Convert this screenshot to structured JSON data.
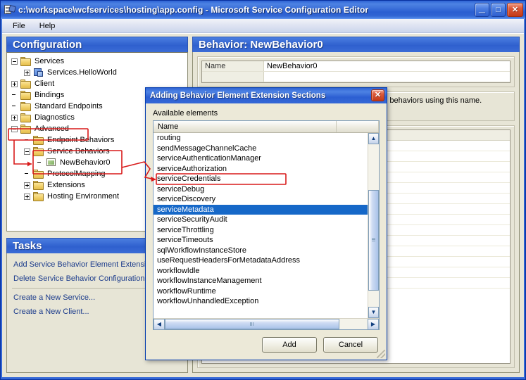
{
  "window": {
    "title": "c:\\workspace\\wcfservices\\hosting\\app.config - Microsoft Service Configuration Editor",
    "icon": "app-config-icon",
    "controls": {
      "minimize": "_",
      "maximize": "□",
      "close": "✕"
    }
  },
  "menu": {
    "items": [
      {
        "label": "File"
      },
      {
        "label": "Help"
      }
    ]
  },
  "configuration_panel": {
    "title": "Configuration",
    "tree": [
      {
        "label": "Services",
        "depth": 0,
        "expander": "minus",
        "icon": "folder-icon"
      },
      {
        "label": "Services.HelloWorld",
        "depth": 1,
        "expander": "plus",
        "icon": "service-icon"
      },
      {
        "label": "Client",
        "depth": 0,
        "expander": "plus",
        "icon": "folder-icon"
      },
      {
        "label": "Bindings",
        "depth": 0,
        "expander": "none",
        "icon": "folder-icon"
      },
      {
        "label": "Standard Endpoints",
        "depth": 0,
        "expander": "none",
        "icon": "folder-icon"
      },
      {
        "label": "Diagnostics",
        "depth": 0,
        "expander": "plus",
        "icon": "folder-icon"
      },
      {
        "label": "Advanced",
        "depth": 0,
        "expander": "minus",
        "icon": "folder-icon"
      },
      {
        "label": "Endpoint Behaviors",
        "depth": 1,
        "expander": "none",
        "icon": "folder-icon"
      },
      {
        "label": "Service Behaviors",
        "depth": 1,
        "expander": "minus",
        "icon": "folder-icon"
      },
      {
        "label": "NewBehavior0",
        "depth": 2,
        "expander": "none",
        "icon": "behavior-icon"
      },
      {
        "label": "ProtocolMapping",
        "depth": 1,
        "expander": "none",
        "icon": "folder-icon"
      },
      {
        "label": "Extensions",
        "depth": 1,
        "expander": "plus",
        "icon": "folder-icon"
      },
      {
        "label": "Hosting Environment",
        "depth": 1,
        "expander": "plus",
        "icon": "folder-icon"
      }
    ]
  },
  "tasks_panel": {
    "title": "Tasks",
    "items": [
      {
        "label": "Add Service Behavior Element Extension"
      },
      {
        "label": "Delete Service Behavior Configuration"
      },
      {
        "label": "Create a New Service..."
      },
      {
        "label": "Create a New Client..."
      }
    ]
  },
  "behavior_panel": {
    "title": "Behavior: NewBehavior0",
    "properties": [
      {
        "key": "Name",
        "value": "NewBehavior0"
      }
    ],
    "description": "Each behavior is indexed by its name. Services link to behaviors using this name. Behaviors are define..."
  },
  "dialog": {
    "title": "Adding Behavior Element Extension Sections",
    "close_label": "✕",
    "available_label": "Available elements",
    "column_header": "Name",
    "items": [
      "routing",
      "sendMessageChannelCache",
      "serviceAuthenticationManager",
      "serviceAuthorization",
      "serviceCredentials",
      "serviceDebug",
      "serviceDiscovery",
      "serviceMetadata",
      "serviceSecurityAudit",
      "serviceThrottling",
      "serviceTimeouts",
      "sqlWorkflowInstanceStore",
      "useRequestHeadersForMetadataAddress",
      "workflowIdle",
      "workflowInstanceManagement",
      "workflowRuntime",
      "workflowUnhandledException"
    ],
    "selected_item": "serviceMetadata",
    "selected_index": 7,
    "scrollbar": {
      "up_arrow": "▲",
      "down_arrow": "▼",
      "left_arrow": "◀",
      "right_arrow": "▶"
    },
    "buttons": [
      {
        "label": "Add"
      },
      {
        "label": "Cancel"
      }
    ]
  },
  "colors": {
    "titlebar_blue": "#2f63d3",
    "panel_header_blue": "#3b6cd6",
    "selection_blue": "#1668c8",
    "window_face": "#e7e5d6",
    "dialog_face": "#ece9d8",
    "annotation_red": "#d81a1a",
    "task_link": "#1c3c8c"
  },
  "annotations": {
    "highlight_boxes": [
      "advanced-node",
      "service-behaviors-subtree",
      "serviceMetadata-list-item"
    ],
    "arrows": [
      "advanced-to-service-behaviors",
      "newbehavior0-to-serviceMetadata"
    ]
  }
}
